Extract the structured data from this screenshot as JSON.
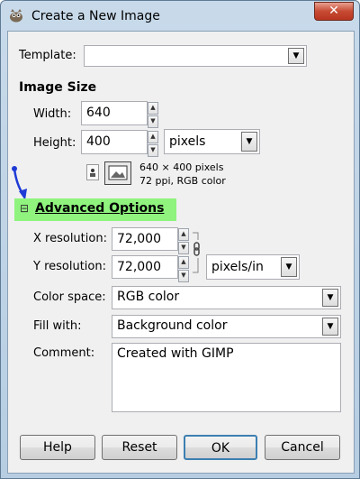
{
  "window": {
    "title": "Create a New Image",
    "close_glyph": "✕"
  },
  "template": {
    "label": "Template:",
    "value": ""
  },
  "image_size": {
    "heading": "Image Size",
    "width_label": "Width:",
    "width_value": "640",
    "height_label": "Height:",
    "height_value": "400",
    "unit": "pixels",
    "info_line1": "640 × 400 pixels",
    "info_line2": "72 ppi, RGB color"
  },
  "advanced": {
    "toggle_glyph": "⊟",
    "heading": "Advanced Options",
    "xres_label": "X resolution:",
    "xres_value": "72,000",
    "yres_label": "Y resolution:",
    "yres_value": "72,000",
    "res_unit": "pixels/in",
    "colorspace_label": "Color space:",
    "colorspace_value": "RGB color",
    "fill_label": "Fill with:",
    "fill_value": "Background color",
    "comment_label": "Comment:",
    "comment_value": "Created with GIMP"
  },
  "buttons": {
    "help": "Help",
    "reset": "Reset",
    "ok": "OK",
    "cancel": "Cancel"
  },
  "icons": {
    "combo_arrow": "▼",
    "spin_up": "▲",
    "spin_down": "▼"
  },
  "colors": {
    "advanced_highlight": "#8ff37e",
    "annotation_arrow": "#1f3bd6"
  }
}
